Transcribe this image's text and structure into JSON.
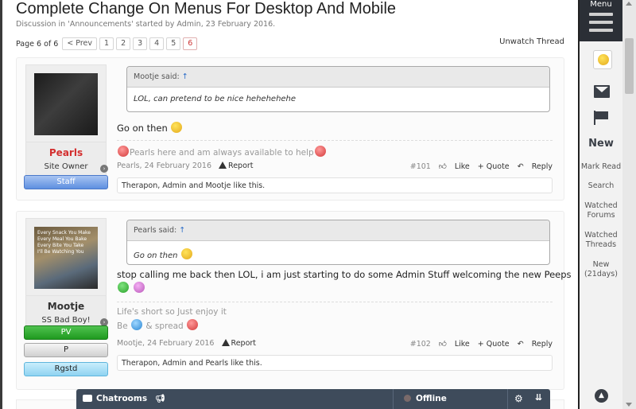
{
  "thread": {
    "title": "Complete Change On Menus For Desktop And Mobile",
    "meta": "Discussion in 'Announcements' started by Admin, 23 February 2016.",
    "unwatch": "Unwatch Thread"
  },
  "pager": {
    "label": "Page 6 of 6",
    "prev": "< Prev",
    "pages": [
      "1",
      "2",
      "3",
      "4",
      "5",
      "6"
    ],
    "current": "6"
  },
  "posts": [
    {
      "username": "Pearls",
      "user_title": "Site Owner",
      "banners": [
        "Staff"
      ],
      "quote_author": "Mootje said:",
      "quote_arrow": "↑",
      "quote_text": "LOL, can pretend to be nice hehehehehe",
      "message": "Go on then",
      "signature": [
        "Pearls here and am always available to help"
      ],
      "date": "Pearls, 24 February 2016",
      "report": "Report",
      "number": "#101",
      "like": "Like",
      "quote": "+ Quote",
      "reply": "Reply",
      "likes": "Therapon, Admin and Mootje like this."
    },
    {
      "username": "Mootje",
      "user_title": "SS Bad Boy!",
      "avatar_text": "Every Snack You Make\nEvery Meal You Bake\nEvery Bite You Take\nI'll Be Watching You",
      "banners": [
        "PV",
        "P",
        "Rgstd"
      ],
      "quote_author": "Pearls said:",
      "quote_arrow": "↑",
      "quote_text": "Go on then",
      "message": "stop calling me back then LOL, i am just starting to do some Admin Stuff welcoming the new Peeps",
      "signature": [
        "Life's short so Just enjoy it",
        "Be",
        "& spread"
      ],
      "date": "Mootje, 24 February 2016",
      "report": "Report",
      "number": "#102",
      "like": "Like",
      "quote": "+ Quote",
      "reply": "Reply",
      "likes": "Therapon, Admin and Pearls like this."
    }
  ],
  "chat": {
    "label": "Chatrooms",
    "status": "Offline"
  },
  "right_bar": {
    "menu": "Menu",
    "new": "New",
    "mark_read": "Mark Read",
    "search": "Search",
    "watched_forums": "Watched\nForums",
    "watched_threads": "Watched\nThreads",
    "new_21": "New\n(21days)"
  },
  "icons": {
    "hamburger": "hamburger-icon",
    "envelope": "envelope-icon",
    "flag": "flag-icon",
    "gear": "gear-icon",
    "collapse": "double-chevron-down-icon",
    "up": "arrow-up-icon"
  },
  "colors": {
    "username_staff": "#d32f2f",
    "quote_arrow": "#2a6cc8",
    "chatbar": "#3e4b5b",
    "menu_head": "#2b2f36",
    "pv_banner": "#1f9a1f",
    "staff_banner": "#5e8fe0"
  }
}
